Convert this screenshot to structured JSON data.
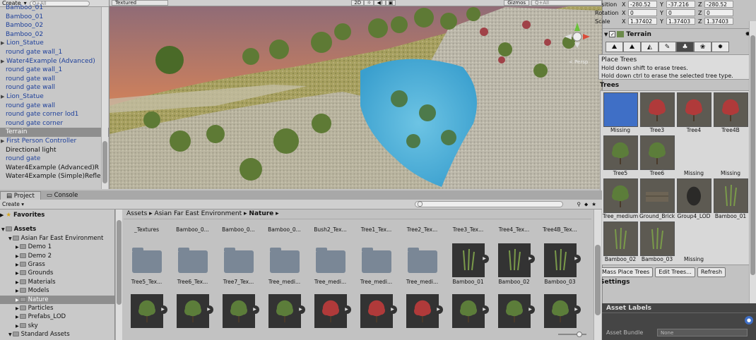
{
  "hierarchy": {
    "create_label": "Create",
    "search_placeholder": "Q+All",
    "items": [
      {
        "label": "Bamboo_01",
        "style": "blue"
      },
      {
        "label": "Bamboo_01",
        "style": "blue"
      },
      {
        "label": "Bamboo_02",
        "style": "blue"
      },
      {
        "label": "Bamboo_02",
        "style": "blue"
      },
      {
        "label": "Lion_Statue",
        "style": "blue",
        "arrow": true
      },
      {
        "label": "round gate wall_1",
        "style": "blue"
      },
      {
        "label": "Water4Example (Advanced)",
        "style": "blue",
        "arrow": true
      },
      {
        "label": "round gate wall_1",
        "style": "blue"
      },
      {
        "label": "round gate wall",
        "style": "blue"
      },
      {
        "label": "round gate wall",
        "style": "blue"
      },
      {
        "label": "Lion_Statue",
        "style": "blue",
        "arrow": true
      },
      {
        "label": "round gate wall",
        "style": "blue"
      },
      {
        "label": "round gate corner lod1",
        "style": "blue"
      },
      {
        "label": "round gate corner",
        "style": "blue"
      },
      {
        "label": "Terrain",
        "style": "selected"
      },
      {
        "label": "First Person Controller",
        "style": "blue",
        "arrow": true
      },
      {
        "label": "Directional light",
        "style": "black"
      },
      {
        "label": "round gate",
        "style": "blue"
      },
      {
        "label": "Water4Example (Advanced)R",
        "style": "black"
      },
      {
        "label": "Water4Example (Simple)Refle",
        "style": "black"
      }
    ]
  },
  "scene": {
    "shading_mode": "Textured",
    "mode_2d": "2D",
    "gizmos_label": "Gizmos",
    "search_placeholder": "Q+All",
    "persp_label": "< Persp"
  },
  "inspector": {
    "transform": {
      "position_label": "Position",
      "position": [
        "-280.52",
        "-37.216",
        "-280.52"
      ],
      "rotation_label": "Rotation",
      "rotation": [
        "0",
        "0",
        "0"
      ],
      "scale_label": "Scale",
      "scale": [
        "1.37402",
        "1.37403",
        "1.37403"
      ]
    },
    "component_title": "Terrain",
    "tool_section": "Place Trees",
    "help_lines": [
      "Hold down shift to erase trees.",
      "Hold down ctrl to erase the selected tree type."
    ],
    "trees_header": "Trees",
    "trees": [
      {
        "label": "Missing",
        "kind": "selected"
      },
      {
        "label": "Tree3",
        "kind": "red"
      },
      {
        "label": "Tree4",
        "kind": "red"
      },
      {
        "label": "Tree4B",
        "kind": "red"
      },
      {
        "label": "Tree5",
        "kind": "green"
      },
      {
        "label": "Tree6",
        "kind": "green"
      },
      {
        "label": "Missing",
        "kind": "empty"
      },
      {
        "label": "Missing",
        "kind": "empty"
      },
      {
        "label": "Tree_medium",
        "kind": "green"
      },
      {
        "label": "Ground_Bricks",
        "kind": "brick"
      },
      {
        "label": "Group4_LOD",
        "kind": "rock"
      },
      {
        "label": "Bamboo_01",
        "kind": "bamboo"
      },
      {
        "label": "Bamboo_02",
        "kind": "bamboo"
      },
      {
        "label": "Bamboo_03",
        "kind": "bamboo"
      },
      {
        "label": "Missing",
        "kind": "empty"
      }
    ],
    "btn_mass": "Mass Place Trees",
    "btn_edit": "Edit Trees...",
    "btn_refresh": "Refresh",
    "settings_header": "Settings"
  },
  "asset_labels": {
    "title": "Asset Labels",
    "bundle_label": "Asset Bundle",
    "bundle_value": "None"
  },
  "project": {
    "tab_project": "Project",
    "tab_console": "Console",
    "create_label": "Create",
    "favorites": "Favorites",
    "tree": [
      {
        "label": "Assets",
        "indent": 0,
        "bold": true
      },
      {
        "label": "Asian Far East Environment",
        "indent": 1
      },
      {
        "label": "Demo 1",
        "indent": 2
      },
      {
        "label": "Demo 2",
        "indent": 2
      },
      {
        "label": "Grass",
        "indent": 2
      },
      {
        "label": "Grounds",
        "indent": 2
      },
      {
        "label": "Materials",
        "indent": 2
      },
      {
        "label": "Models",
        "indent": 2
      },
      {
        "label": "Nature",
        "indent": 2,
        "selected": true
      },
      {
        "label": "Particles",
        "indent": 2
      },
      {
        "label": "Prefabs_LOD",
        "indent": 2
      },
      {
        "label": "sky",
        "indent": 2
      },
      {
        "label": "Standard Assets",
        "indent": 1
      }
    ],
    "breadcrumb": [
      "Assets",
      "Asian Far East Environment",
      "Nature"
    ],
    "row1": [
      "_Textures",
      "Bamboo_0...",
      "Bamboo_0...",
      "Bamboo_0...",
      "Bush2_Tex...",
      "Tree1_Tex...",
      "Tree2_Tex...",
      "Tree3_Tex...",
      "Tree4_Tex...",
      "Tree4B_Tex..."
    ],
    "row2": [
      {
        "label": "Tree5_Tex...",
        "type": "folder"
      },
      {
        "label": "Tree6_Tex...",
        "type": "folder"
      },
      {
        "label": "Tree7_Tex...",
        "type": "folder"
      },
      {
        "label": "Tree_medi...",
        "type": "folder"
      },
      {
        "label": "Tree_medi...",
        "type": "folder"
      },
      {
        "label": "Tree_medi...",
        "type": "folder"
      },
      {
        "label": "Tree_medi...",
        "type": "folder"
      },
      {
        "label": "Bamboo_01",
        "type": "bamboo"
      },
      {
        "label": "Bamboo_02",
        "type": "bamboo"
      },
      {
        "label": "Bamboo_03",
        "type": "bamboo"
      }
    ],
    "row3": [
      "green",
      "green",
      "green",
      "green",
      "red",
      "red",
      "red",
      "green",
      "green",
      "green"
    ]
  },
  "colors": {
    "accent": "#3f6fc6",
    "hier_link": "#1d3f9a",
    "water": "#4fb0d8"
  }
}
